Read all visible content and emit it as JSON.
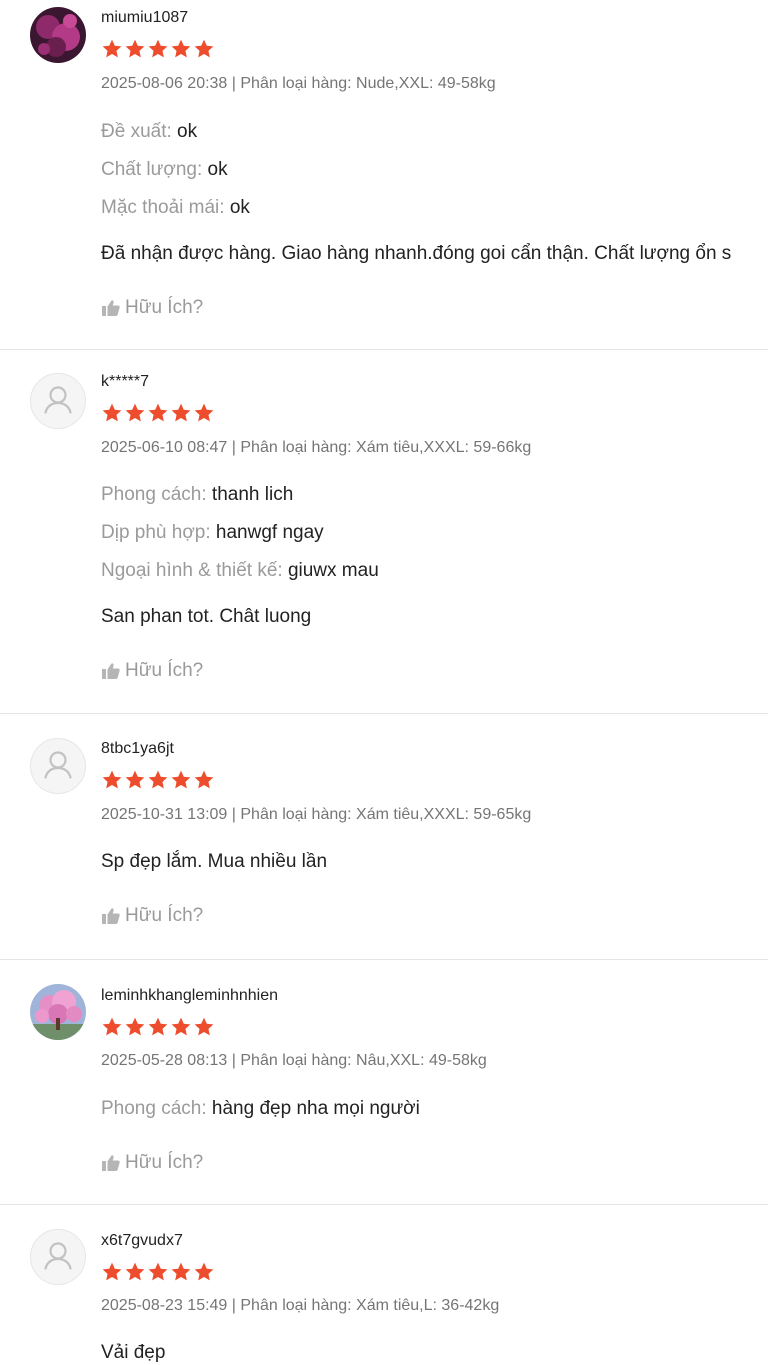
{
  "colors": {
    "star": "#ee4d2d",
    "meta_text": "#757575",
    "attr_key": "#9a9a9a",
    "separator": "#e5e5e5"
  },
  "helpful_label": "Hữu Ích?",
  "reviews": [
    {
      "username": "miumiu1087",
      "avatar": "photo-avatar",
      "rating": 5,
      "meta": "2025-08-06 20:38 | Phân loại hàng: Nude,XXL: 49-58kg",
      "attributes": [
        {
          "key": "Đề xuất:",
          "value": "ok"
        },
        {
          "key": "Chất lượng:",
          "value": "ok"
        },
        {
          "key": "Mặc thoải mái:",
          "value": "ok"
        }
      ],
      "content": "Đã nhận được hàng. Giao hàng nhanh.đóng goi cẩn thận. Chất lượng ổn s"
    },
    {
      "username": "k*****7",
      "avatar": "default-user-icon",
      "rating": 5,
      "meta": "2025-06-10 08:47 | Phân loại hàng: Xám tiêu,XXXL: 59-66kg",
      "attributes": [
        {
          "key": "Phong cách:",
          "value": "thanh lich"
        },
        {
          "key": "Dịp phù hợp:",
          "value": "hanwgf ngay"
        },
        {
          "key": "Ngoại hình & thiết kế:",
          "value": "giuwx mau"
        }
      ],
      "content": "San phan tot. Chât luong"
    },
    {
      "username": "8tbc1ya6jt",
      "avatar": "default-user-icon",
      "rating": 5,
      "meta": "2025-10-31 13:09 | Phân loại hàng: Xám tiêu,XXXL: 59-65kg",
      "attributes": [],
      "content": "Sp đẹp lắm. Mua nhiều lần"
    },
    {
      "username": "leminhkhangleminhnhien",
      "avatar": "photo-avatar",
      "rating": 5,
      "meta": "2025-05-28 08:13 | Phân loại hàng: Nâu,XXL: 49-58kg",
      "attributes": [
        {
          "key": "Phong cách:",
          "value": "hàng đẹp nha mọi người"
        }
      ],
      "content": ""
    },
    {
      "username": "x6t7gvudx7",
      "avatar": "default-user-icon",
      "rating": 5,
      "meta": "2025-08-23 15:49 | Phân loại hàng: Xám tiêu,L: 36-42kg",
      "attributes": [],
      "content": "Vải đẹp"
    }
  ]
}
